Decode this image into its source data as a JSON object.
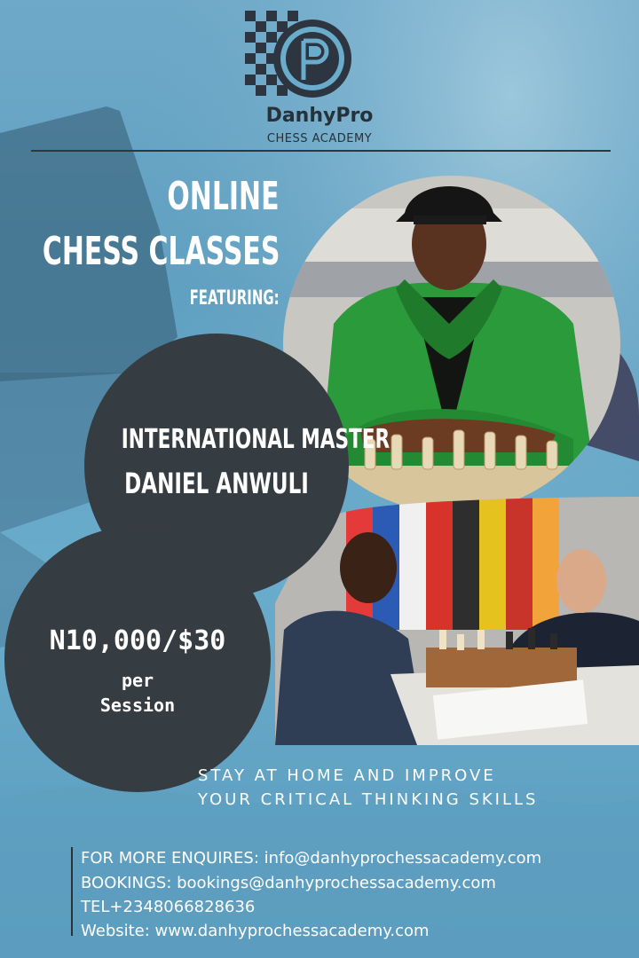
{
  "brand": {
    "name": "DanhyPro",
    "tagline": "CHESS ACADEMY"
  },
  "headline": {
    "line1": "ONLINE",
    "line2": "CHESS CLASSES",
    "line3": "FEATURING:"
  },
  "master": {
    "title": "INTERNATIONAL MASTER",
    "name": "DANIEL ANWULI"
  },
  "price": {
    "amount": "N10,000/$30",
    "per": "per",
    "unit": "Session"
  },
  "slogan": {
    "line1": "STAY AT HOME AND IMPROVE",
    "line2": "YOUR CRITICAL THINKING SKILLS"
  },
  "contacts": {
    "enquiries_label": "FOR MORE ENQUIRES:",
    "enquiries_value": " info@danhyprochessacademy.com",
    "bookings_label": "BOOKINGS:",
    "bookings_value": " bookings@danhyprochessacademy.com",
    "tel_label": "TEL",
    "tel_value": "+2348066828636",
    "website_label": "Website:",
    "website_value": " www.danhyprochessacademy.com"
  },
  "colors": {
    "background": "#5f9fc0",
    "circle": "#363d42",
    "text": "#ffffff",
    "brand_text": "#27313a",
    "jacket": "#2a9a3a"
  },
  "icons": [
    "chessboard-logo-icon",
    "dp-monogram-icon",
    "chess-king-silhouette-icon"
  ]
}
